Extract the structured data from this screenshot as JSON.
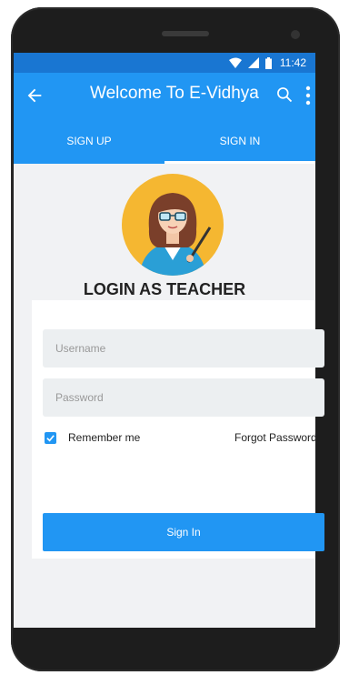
{
  "status_bar": {
    "time": "11:42",
    "icons": [
      "wifi-icon",
      "signal-icon",
      "battery-icon"
    ]
  },
  "app_bar": {
    "title": "Welcome To E-Vidhya",
    "icons": [
      "back-arrow-icon",
      "search-icon",
      "more-vert-icon"
    ]
  },
  "tabs": [
    {
      "label": "SIGN UP",
      "selected": false
    },
    {
      "label": "SIGN IN",
      "selected": true
    }
  ],
  "login": {
    "avatar": "teacher-avatar",
    "heading": "LOGIN AS TEACHER",
    "username_placeholder": "Username",
    "password_placeholder": "Password",
    "remember_label": "Remember me",
    "remember_checked": true,
    "forgot_label": "Forgot Password",
    "submit_label": "Sign In"
  },
  "colors": {
    "primary": "#2196f3",
    "primary_dark": "#1976d2",
    "background": "#f1f2f4",
    "avatar_bg": "#f5b731"
  }
}
